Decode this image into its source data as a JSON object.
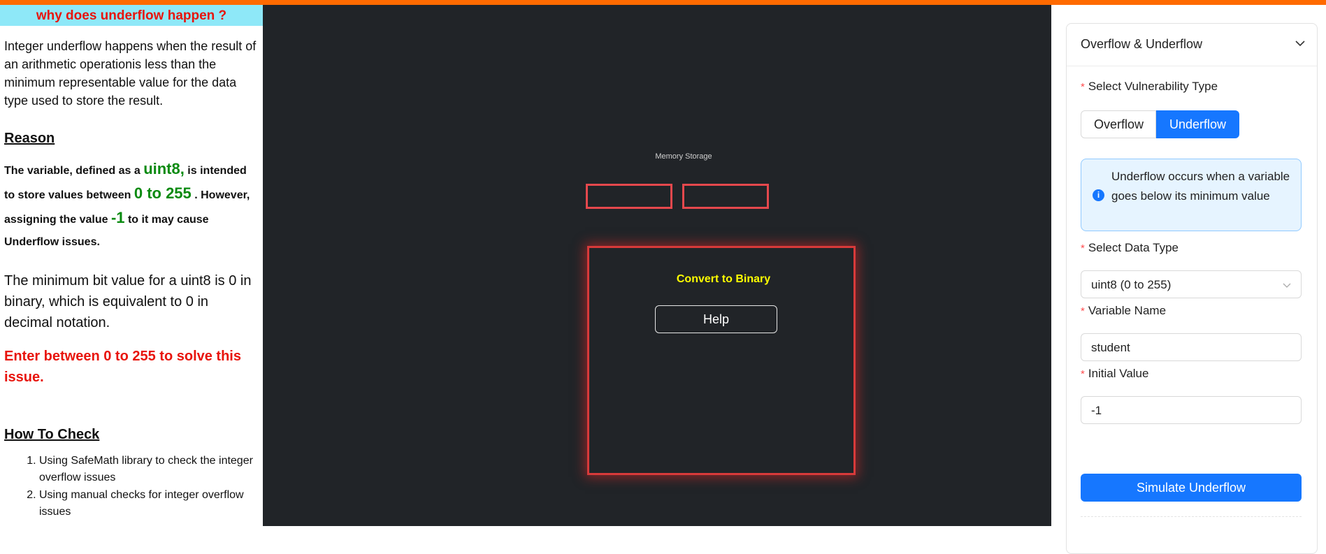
{
  "left": {
    "title": "why does underflow happen ?",
    "intro": "Integer underflow happens when the result of an arithmetic operationis less than the minimum representable value for the data type used to store the result.",
    "reason_heading": "Reason",
    "reason": {
      "p1": "The variable, defined as a ",
      "type": "uint8,",
      "p2": " is intended to store values between ",
      "range": "0 to 255",
      "p3": " . However, assigning the value ",
      "value": "-1",
      "p4": " to it may cause Underflow issues."
    },
    "min_bit": "The minimum bit value for a uint8 is 0 in binary, which is equivalent to 0 in decimal notation.",
    "solve": "Enter between 0 to 255 to solve this issue.",
    "check_heading": "How To Check",
    "checks": [
      "Using SafeMath library to check the integer overflow issues",
      "Using manual checks for integer overflow issues"
    ]
  },
  "center": {
    "memory_label": "Memory Storage",
    "convert_title": "Convert to Binary",
    "help_label": "Help"
  },
  "right": {
    "panel_title": "Overflow & Underflow",
    "vuln_label": "Select Vulnerability Type",
    "options": [
      "Overflow",
      "Underflow"
    ],
    "selected_option": "Underflow",
    "info": "Underflow occurs when a variable goes below its minimum value",
    "datatype_label": "Select Data Type",
    "datatype_value": "uint8 (0 to 255)",
    "varname_label": "Variable Name",
    "varname_value": "student",
    "initial_label": "Initial Value",
    "initial_value": "-1",
    "simulate_label": "Simulate Underflow"
  },
  "colors": {
    "top_bar": "#ff6a00",
    "title_bg": "#8ee8f8",
    "accent_red": "#e8140c",
    "accent_green": "#0a8a10",
    "primary": "#1677ff",
    "canvas_bg": "#212428",
    "slot_border": "#e5484d",
    "binary_title": "#ffff00"
  },
  "icons": {
    "collapse": "chevron-down-icon",
    "info": "info-icon",
    "select": "chevron-down-icon"
  }
}
